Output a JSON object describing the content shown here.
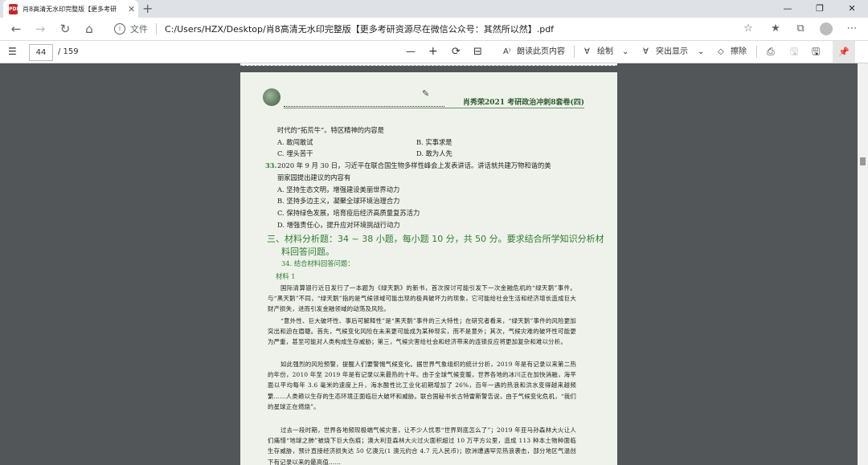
{
  "tab": {
    "icon": "pdf-icon",
    "title": "肖8高清无水印完整版【更多考研",
    "close": "✕",
    "new_tab": "+"
  },
  "window": {
    "minimize": "—",
    "maximize": "❐",
    "close": "✕"
  },
  "address": {
    "back": "←",
    "forward": "→",
    "reload": "↻",
    "home": "⌂",
    "info": "i",
    "label": "文件",
    "url": "C:/Users/HZX/Desktop/肖8高清无水印完整版【更多考研资源尽在微信公众号：其然所以然】.pdf",
    "star": "☆",
    "favorites": "★",
    "collections": "⧉",
    "more": "⋯"
  },
  "toolbar": {
    "contents": "☰",
    "page_number": "44",
    "page_total": "/ 159",
    "zoom_out": "—",
    "zoom_in": "+",
    "rotate": "⟳",
    "fit": "⊟",
    "read_aloud_icon": "A⁾",
    "read_aloud": "朗读此页内容",
    "draw_icon": "∀",
    "draw": "绘制",
    "draw_arrow": "⌄",
    "highlight_icon": "∀",
    "highlight": "突出显示",
    "highlight_arrow": "⌄",
    "erase_icon": "◇",
    "erase": "擦除",
    "print": "⎙",
    "save": "🖫",
    "save_as": "🖫",
    "pin": "📌"
  },
  "doc": {
    "header_title": "肖秀荣2021 考研政治冲刺8套卷(四)",
    "line1": "时代的“拓荒牛”。特区精神的内容是",
    "opt_a1": "A. 敢闯敢试",
    "opt_b1": "B. 实事求是",
    "opt_c1": "C. 埋头苦干",
    "opt_d1": "D. 敢为人先",
    "q33_num": "33.",
    "q33_l1": "2020 年 9 月 30 日，习近平在联合国生物多样性峰会上发表讲话。讲话就共建万物和谐的美",
    "q33_l2": "丽家园提出建议的内容有",
    "q33_a": "A. 坚持生态文明，增强建设美丽世界动力",
    "q33_b": "B. 坚持多边主义，凝聚全球环境治理合力",
    "q33_c": "C. 保持绿色发展，培育疫后经济高质量复苏活力",
    "q33_d": "D. 增强责任心，提升应对环境挑战行动力",
    "sec_l1": "三、材料分析题：34 ~ 38 小题，每小题 10 分，共 50 分。要求结合所学知识分析材",
    "sec_l2": "料回答问题。",
    "q34": "34. 结合材料回答问题：",
    "material1": "材料 1",
    "p1": "国际清算银行近日发行了一本题为《绿天鹅》的新书，首次探讨可能引发下一次金融危机的“绿天鹅”事件。与“黑天鹅”不同，“绿天鹅”指的是气候领域可能出现的极具破坏力的现象，它可能给社会生活和经济增长造成巨大财产损失，进而引发金融领域的动荡及风险。",
    "p2": "“意外性、巨大破坏性、事后可解释性”是“黑天鹅”事件的三大特性；在研究者看来，“绿天鹅”事件的风险更加突出和迫在眉睫。首先，气候变化风险在未来更可能成为某种现实，而不是意外；其次，气候灾难的破坏性可能更为严重，甚至可能对人类构成生存威胁；第三，气候灾害给社会和经济带来的连锁反应将更加复杂和难以分析。",
    "p3": "如此强烈的风险预警，提醒人们要警惕气候变化。据世界气象组织的统计分析，2019 年是有记录以来第二热的年份，2010 年至 2019 年是有记录以来最热的十年。由于全球气候变暖，世界各地的冰川正在加快消融，海平面以平均每年 3.6 毫米的速度上升，海水酸性比工业化初期增加了 26%，百年一遇的热浪和洪水变得越来越频繁……人类赖以生存的生态环境正面临巨大破坏和威胁。联合国秘书长古特雷斯警告说，由于气候变化危机，“我们的星球正在燃烧”。",
    "p4": "过去一段时期，世界各地频现极端气候灾害，让不少人忧思“世界到底怎么了”；2019 年亚马孙森林大火让人们痛惜“地球之肺”被烧下巨大伤痕；澳大利亚森林大火过火面积超过 10 万平方公里，造成 113 种本土物种面临生存威胁，预计直接经济损失达 50 亿澳元(1 澳元约合 4.7 元人民币)；欧洲遭遇罕见热浪袭击，部分地区气温创下有记录以来的最高值……"
  }
}
